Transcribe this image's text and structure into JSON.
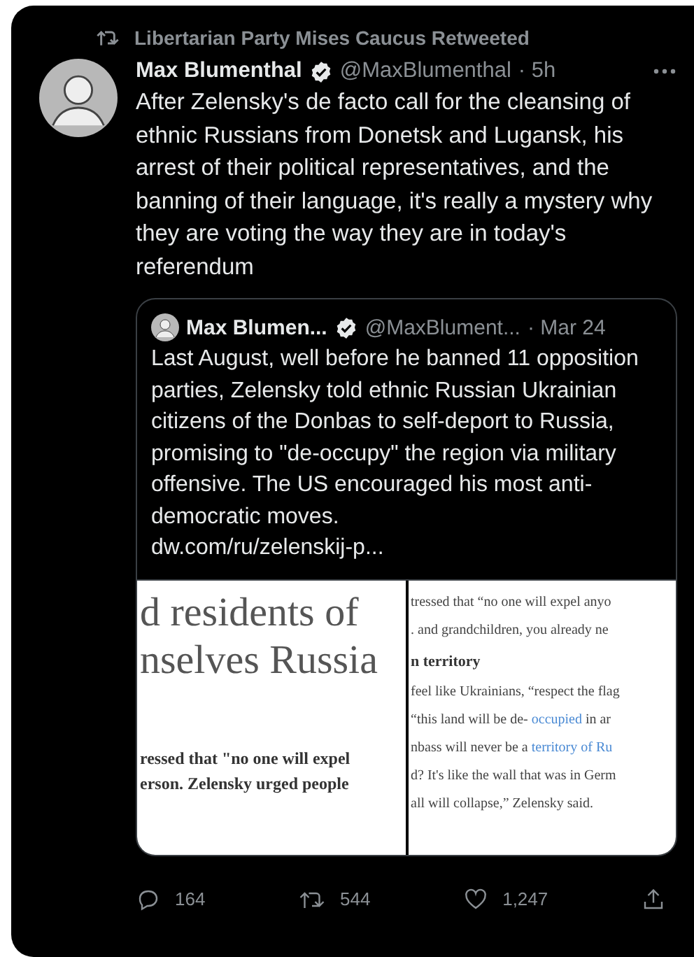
{
  "social_context": {
    "text": "Libertarian Party Mises Caucus Retweeted"
  },
  "tweet": {
    "name": "Max Blumenthal",
    "verified": true,
    "handle": "@MaxBlumenthal",
    "time": "· 5h",
    "text": "After Zelensky's de facto call for the cleansing of ethnic Russians from Donetsk and Lugansk, his arrest of their political representatives, and the banning of their language, it's really a mystery why they are voting the way they are in today's referendum"
  },
  "quote": {
    "name": "Max Blumen...",
    "verified": true,
    "handle": "@MaxBlument...",
    "time": "· Mar 24",
    "text": "Last August, well before he banned 11 opposition parties, Zelensky told ethnic Russian Ukrainian citizens of the Donbas to self-deport to Russia, promising to \"de-occupy\" the region via military offensive. The US encouraged his most anti-democratic moves.",
    "link": "dw.com/ru/zelenskij-p...",
    "images": [
      {
        "lines": [
          {
            "kind": "headline",
            "parts": [
              {
                "text": "d residents of",
                "link": false
              }
            ]
          },
          {
            "kind": "headline",
            "parts": [
              {
                "text": "nselves Russia",
                "link": false
              }
            ]
          },
          {
            "kind": "body",
            "parts": [
              {
                "text": "ressed that \"no one will expel",
                "link": false
              }
            ]
          },
          {
            "kind": "body",
            "parts": [
              {
                "text": "erson. Zelensky urged people",
                "link": false
              }
            ]
          }
        ]
      },
      {
        "lines": [
          {
            "kind": "small",
            "parts": [
              {
                "text": "tressed that “no one will expel anyo",
                "link": false
              }
            ]
          },
          {
            "kind": "small",
            "parts": [
              {
                "text": ". and grandchildren, you already ne",
                "link": false
              }
            ]
          },
          {
            "kind": "subhead",
            "parts": [
              {
                "text": "n territory",
                "link": false
              }
            ]
          },
          {
            "kind": "small",
            "parts": [
              {
                "text": "feel like Ukrainians, “respect the flag",
                "link": false
              }
            ]
          },
          {
            "kind": "small",
            "parts": [
              {
                "text": "“this land will be de- ",
                "link": false
              },
              {
                "text": "occupied",
                "link": true
              },
              {
                "text": " in ar",
                "link": false
              }
            ]
          },
          {
            "kind": "small",
            "parts": [
              {
                "text": "nbass will never be a ",
                "link": false
              },
              {
                "text": "territory of Ru",
                "link": true
              }
            ]
          },
          {
            "kind": "small",
            "parts": [
              {
                "text": "d? It's like the wall that was in Germ",
                "link": false
              }
            ]
          },
          {
            "kind": "small",
            "parts": [
              {
                "text": "all will collapse,” Zelensky said.",
                "link": false
              }
            ]
          }
        ]
      }
    ]
  },
  "actions": [
    {
      "kind": "reply",
      "count": "164"
    },
    {
      "kind": "retweet",
      "count": "544"
    },
    {
      "kind": "like",
      "count": "1,247"
    },
    {
      "kind": "share"
    }
  ]
}
